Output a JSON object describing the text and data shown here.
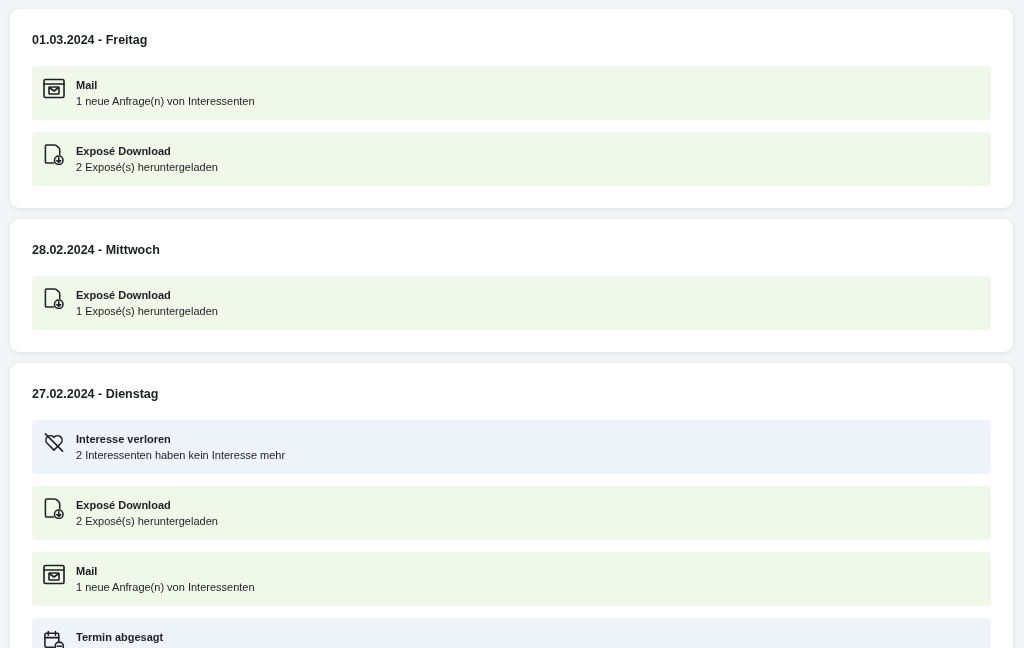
{
  "days": [
    {
      "date": "01.03.2024 - Freitag",
      "events": [
        {
          "kind": "mail",
          "title": "Mail",
          "text": "1 neue Anfrage(n) von Interessenten"
        },
        {
          "kind": "download",
          "title": "Exposé Download",
          "text": "2 Exposé(s) heruntergeladen"
        }
      ]
    },
    {
      "date": "28.02.2024 - Mittwoch",
      "events": [
        {
          "kind": "download",
          "title": "Exposé Download",
          "text": "1 Exposé(s) heruntergeladen"
        }
      ]
    },
    {
      "date": "27.02.2024 - Dienstag",
      "events": [
        {
          "kind": "interest_lost",
          "title": "Interesse verloren",
          "text": "2 Interessenten haben kein Interesse mehr"
        },
        {
          "kind": "download",
          "title": "Exposé Download",
          "text": "2 Exposé(s) heruntergeladen"
        },
        {
          "kind": "mail",
          "title": "Mail",
          "text": "1 neue Anfrage(n) von Interessenten"
        },
        {
          "kind": "appointment_cancelled",
          "title": "Termin abgesagt"
        }
      ]
    }
  ]
}
